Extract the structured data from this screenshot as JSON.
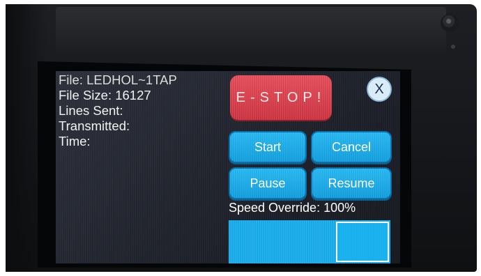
{
  "info": {
    "file": "File: LEDHOL~1TAP",
    "file_size": "File Size: 16127",
    "lines_sent": "Lines Sent:",
    "transmitted": "Transmitted:",
    "time": "Time:"
  },
  "controls": {
    "estop_label": "E-STOP!",
    "close_label": "X",
    "start_label": "Start",
    "cancel_label": "Cancel",
    "pause_label": "Pause",
    "resume_label": "Resume"
  },
  "speed": {
    "label": "Speed Override: 100%",
    "value_percent": 100
  },
  "colors": {
    "button_blue": "#12a6e6",
    "estop_red": "#d63a48",
    "screen_bg": "#242732"
  }
}
